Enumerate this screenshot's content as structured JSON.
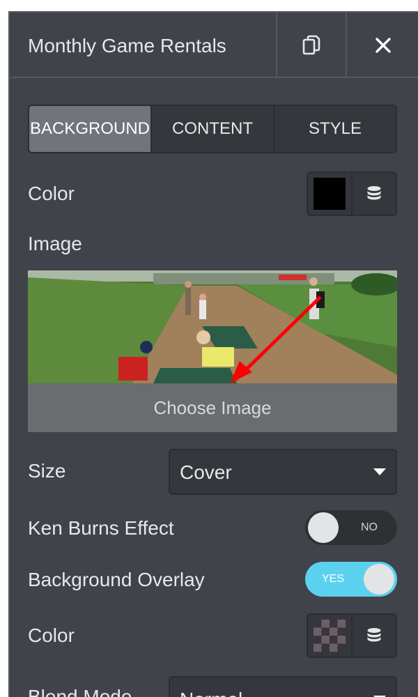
{
  "header": {
    "title": "Monthly Game Rentals",
    "copy_icon": "copy-icon",
    "close_icon": "close-icon"
  },
  "tabs": [
    {
      "label": "BACKGROUND",
      "active": true
    },
    {
      "label": "CONTENT",
      "active": false
    },
    {
      "label": "STYLE",
      "active": false
    }
  ],
  "background": {
    "color_label": "Color",
    "color_value": "#000000",
    "image_label": "Image",
    "choose_image_label": "Choose Image",
    "size_label": "Size",
    "size_value": "Cover",
    "ken_burns_label": "Ken Burns Effect",
    "ken_burns_state": "NO",
    "overlay_label": "Background Overlay",
    "overlay_state": "YES",
    "overlay_color_label": "Color",
    "blend_mode_label": "Blend Mode",
    "blend_mode_value": "Normal"
  },
  "colors": {
    "panel_bg": "#404349",
    "active_tab": "#71747a",
    "toggle_on": "#5bd1ef",
    "arrow": "#ff0000"
  },
  "icons": [
    "copy-icon",
    "close-icon",
    "database-icon",
    "chevron-down-icon"
  ]
}
